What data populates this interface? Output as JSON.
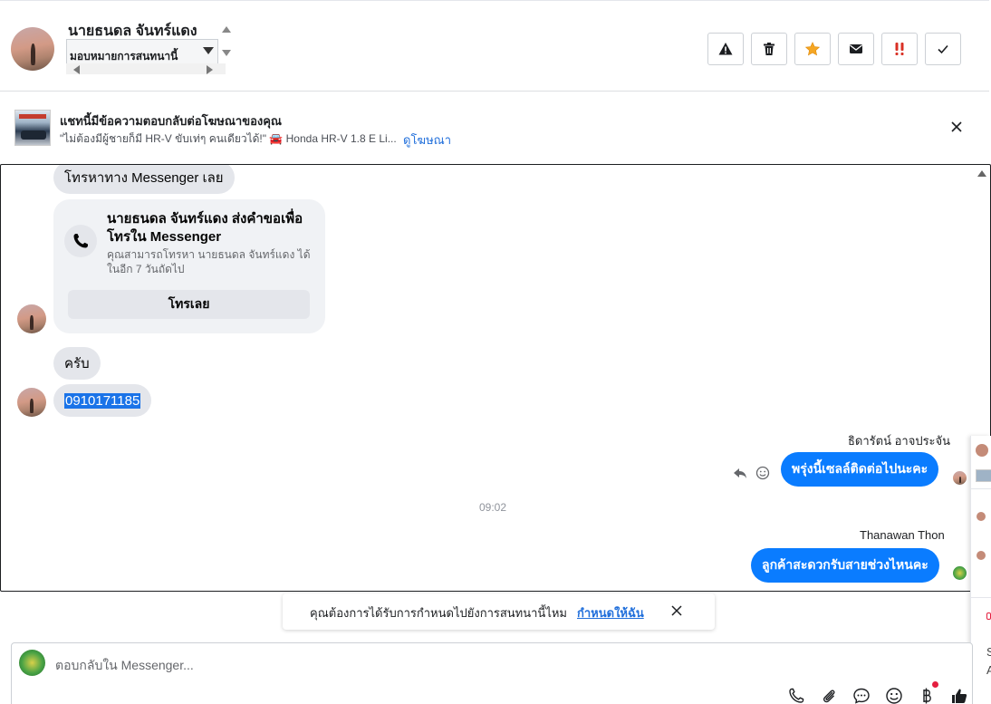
{
  "header": {
    "contact_name": "นายธนดล จันทร์แดง",
    "assign_label": "มอบหมายการสนทนานี้",
    "toolbar": [
      {
        "name": "spam-button",
        "icon": "warning-icon"
      },
      {
        "name": "delete-button",
        "icon": "trash-icon"
      },
      {
        "name": "star-button",
        "icon": "star-icon"
      },
      {
        "name": "mark-unread-button",
        "icon": "envelope-icon"
      },
      {
        "name": "important-button",
        "icon": "double-exclamation-icon"
      },
      {
        "name": "done-button",
        "icon": "check-icon"
      }
    ]
  },
  "ad_banner": {
    "title": "แชทนี้มีข้อความตอบกลับต่อโฆษณาของคุณ",
    "description": "\"ไม่ต้องมีผู้ชายก็มี HR-V ขับเท่ๆ คนเดียวได้!\" 🚘 Honda HR-V 1.8 E Li...",
    "link": "ดูโฆษณา"
  },
  "messages": {
    "messenger_call": "โทรหาทาง Messenger เลย",
    "call_card": {
      "title": "นายธนดล จันทร์แดง ส่งคำขอเพื่อโทรใน Messenger",
      "subtitle": "คุณสามารถโทรหา นายธนดล จันทร์แดง ได้ในอีก 7 วันถัดไป",
      "button": "โทรเลย"
    },
    "reply_1": "ครับ",
    "phone": "0910171185",
    "out_1": {
      "sender": "ธิดารัตน์ อาจประจัน",
      "text": "พรุ่งนี้เซลล์ติดต่อไปนะคะ"
    },
    "timestamp": "09:02",
    "out_2": {
      "sender": "Thanawan Thon",
      "text": "ลูกค้าสะดวกรับสายช่วงไหนคะ"
    }
  },
  "followup_toast": {
    "text": "คุณต้องการได้รับการกำหนดไปยังการสนทนานี้ไหม",
    "link": "กำหนดให้ฉัน"
  },
  "composer": {
    "placeholder": "ตอบกลับใน Messenger...",
    "icons": [
      "phone-icon",
      "paperclip-icon",
      "chat-bubble-icon",
      "emoji-icon",
      "baht-icon",
      "thumbs-up-icon"
    ]
  },
  "side_panel": {
    "letter_1": "S",
    "letter_2": "A"
  },
  "colors": {
    "messenger_blue": "#0a7cff",
    "link_blue": "#216fdb",
    "bubble_gray": "#e4e6eb"
  }
}
